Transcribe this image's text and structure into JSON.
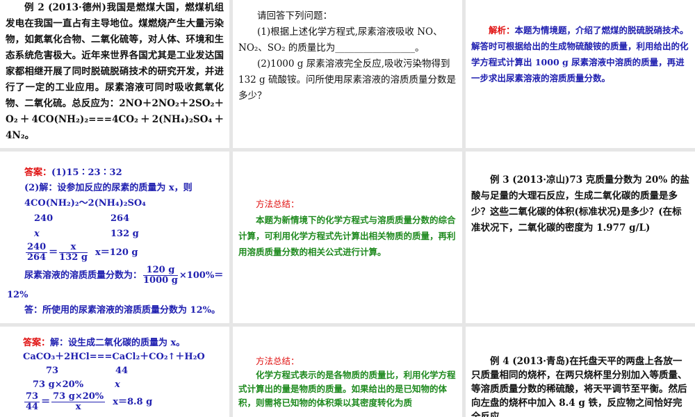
{
  "p1": {
    "lines": [
      "例 2 (2013·德州)我国是燃煤大国，燃煤机组发电在我国一直占有主导地位。煤燃烧产生大量污染物，如氮氧化合物、二氧化硫等，对人体、环境和生态系统危害极大。近年来世界各国尤其是工业发达国家都相继开展了同时脱硫脱硝技术的研究开发，并进行了一定的工业应用。尿素溶液可同时吸收氮氧化物、二氧化硫。总反应为：2NO＋2NO₂＋2SO₂＋O₂＋4CO(NH₂)₂===4CO₂＋2(NH₄)₂SO₄＋4N₂。"
    ]
  },
  "p2": {
    "intro": "请回答下列问题：",
    "q1": "(1)根据上述化学方程式,尿素溶液吸收 NO、NO₂、SO₂ 的质量比为_________________。",
    "q2": "(2)1000 g 尿素溶液完全反应,吸收污染物得到 132 g 硫酸铵。问所使用尿素溶液的溶质质量分数是多少？"
  },
  "p3": {
    "label": "解析：",
    "text": "本题为情境题，介绍了燃煤的脱硫脱硝技术。解答时可根据给出的生成物硫酸铵的质量，利用给出的化学方程式计算出 1000 g 尿素溶液中溶质的质量，再进一步求出尿素溶液的溶质质量分数。"
  },
  "p4": {
    "label": "答案：",
    "a1": "(1)15∶23∶32",
    "a2": "(2)解：设参加反应的尿素的质量为 x，则",
    "eq": "4CO(NH₂)₂～2(NH₄)₂SO₄",
    "m1": "240",
    "m2": "264",
    "v1": "x",
    "v2": "132 g",
    "f1n": "240",
    "f1d": "264",
    "eqsign": "＝",
    "f2n": "x",
    "f2d": "132 g",
    "res": "x＝120 g",
    "pct_label": "尿素溶液的溶质质量分数为：",
    "f3n": "120 g",
    "f3d": "1000 g",
    "pct_tail": "×100%＝",
    "pct_val": "12%",
    "ans": "答：所使用的尿素溶液的溶质质量分数为 12%。"
  },
  "p5": {
    "label": "方法总结：",
    "text": "本题为新情境下的化学方程式与溶质质量分数的综合计算，可利用化学方程式先计算出相关物质的质量，再利用溶质质量分数的相关公式进行计算。"
  },
  "p6": {
    "text": "例 3 (2013·凉山)73 克质量分数为 20% 的盐酸与足量的大理石反应，生成二氧化碳的质量是多少？这些二氧化碳的体积(标准状况)是多少？(在标准状况下，二氧化碳的密度为 1.977 g/L)"
  },
  "p7": {
    "label": "答案：",
    "a1": "解：设生成二氧化碳的质量为 x。",
    "eq": "CaCO₃＋2HCl===CaCl₂＋CO₂↑＋H₂O",
    "m1": "73",
    "m2": "44",
    "v1": "73 g×20%",
    "v2": "x",
    "f1n": "73",
    "f1d": "44",
    "eqsign": "＝",
    "f2n": "73 g×20%",
    "f2d": "x",
    "res": "x＝8.8 g"
  },
  "p8": {
    "label": "方法总结：",
    "text": "化学方程式表示的是各物质的质量比，利用化学方程式计算出的量是物质的质量。如果给出的是已知物的体积，则需将已知物的体积乘以其密度转化为质"
  },
  "p9": {
    "text": "例 4 (2013·青岛)在托盘天平的两盘上各放一只质量相同的烧杯，在两只烧杯里分别加入等质量、等溶质质量分数的稀硫酸，将天平调节至平衡。然后向左盘的烧杯中加入 8.4 g 铁，反应物之间恰好完全反应。"
  }
}
